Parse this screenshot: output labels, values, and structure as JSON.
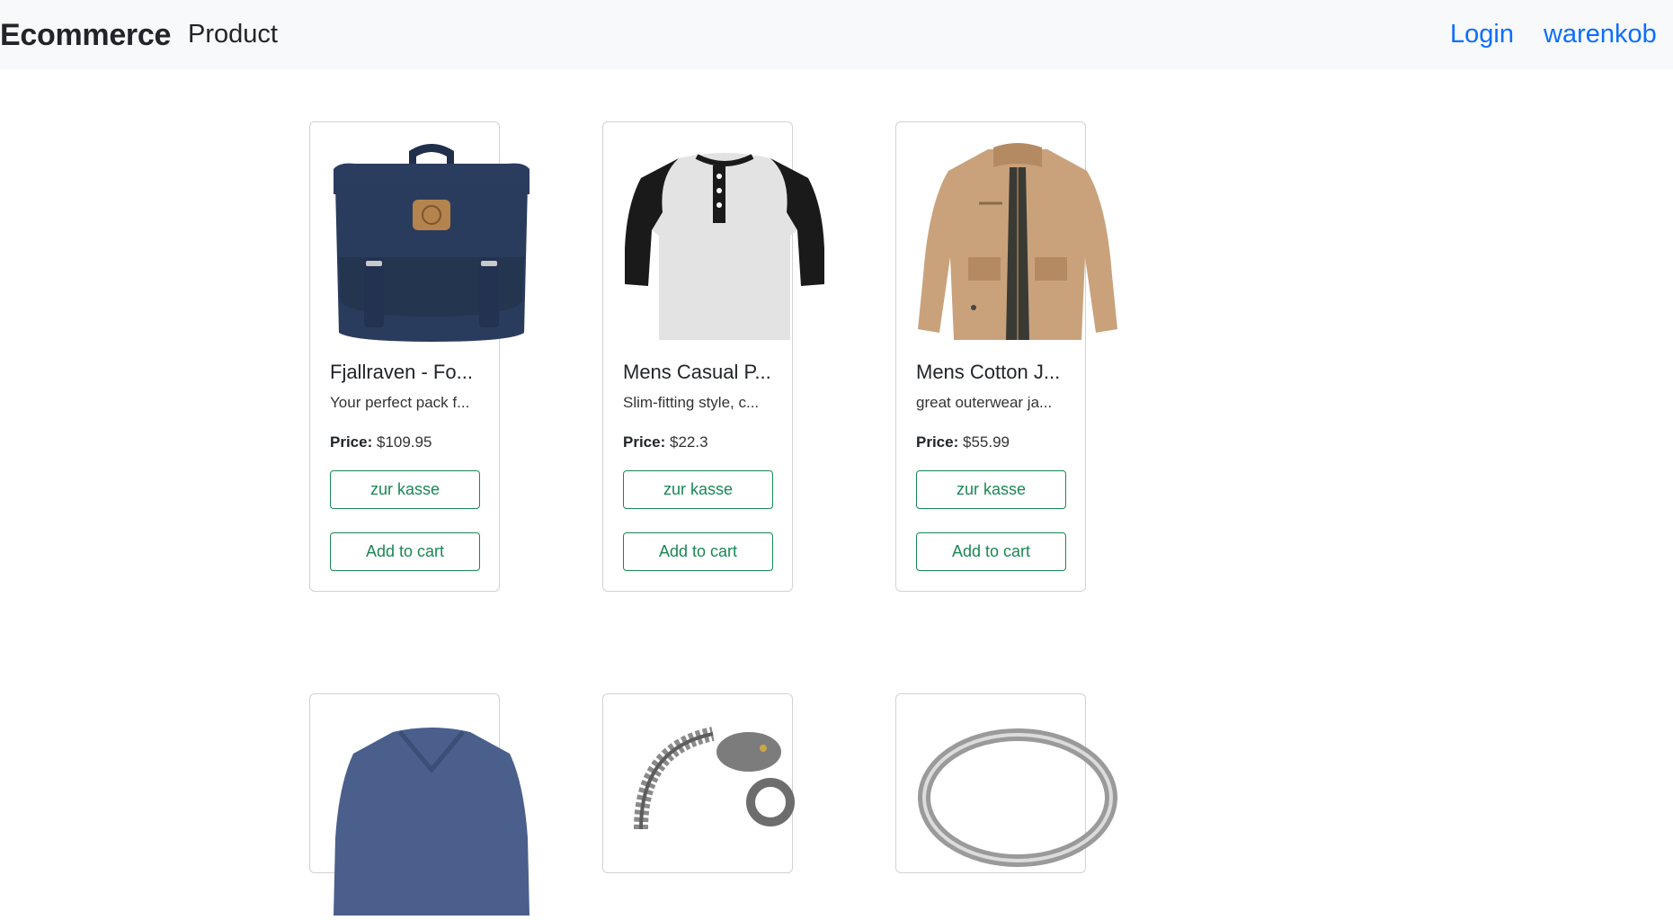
{
  "navbar": {
    "brand": "Ecommerce",
    "product_link": "Product",
    "login_link": "Login",
    "cart_link": "warenkob"
  },
  "products": [
    {
      "title": "Fjallraven - Fo...",
      "description": "Your perfect pack f...",
      "price_label": "Price:",
      "price": "$109.95",
      "checkout_label": "zur kasse",
      "add_label": "Add to cart",
      "image_icon": "backpack-image"
    },
    {
      "title": "Mens Casual P...",
      "description": "Slim-fitting style, c...",
      "price_label": "Price:",
      "price": "$22.3",
      "checkout_label": "zur kasse",
      "add_label": "Add to cart",
      "image_icon": "tshirt-image"
    },
    {
      "title": "Mens Cotton J...",
      "description": "great outerwear ja...",
      "price_label": "Price:",
      "price": "$55.99",
      "checkout_label": "zur kasse",
      "add_label": "Add to cart",
      "image_icon": "jacket-image"
    },
    {
      "image_icon": "longsleeve-shirt-image"
    },
    {
      "image_icon": "bracelet-image"
    },
    {
      "image_icon": "ring-image"
    }
  ],
  "colors": {
    "navbar_bg": "#f8f9fa",
    "link_blue": "#0d6efd",
    "button_green": "#198754"
  }
}
